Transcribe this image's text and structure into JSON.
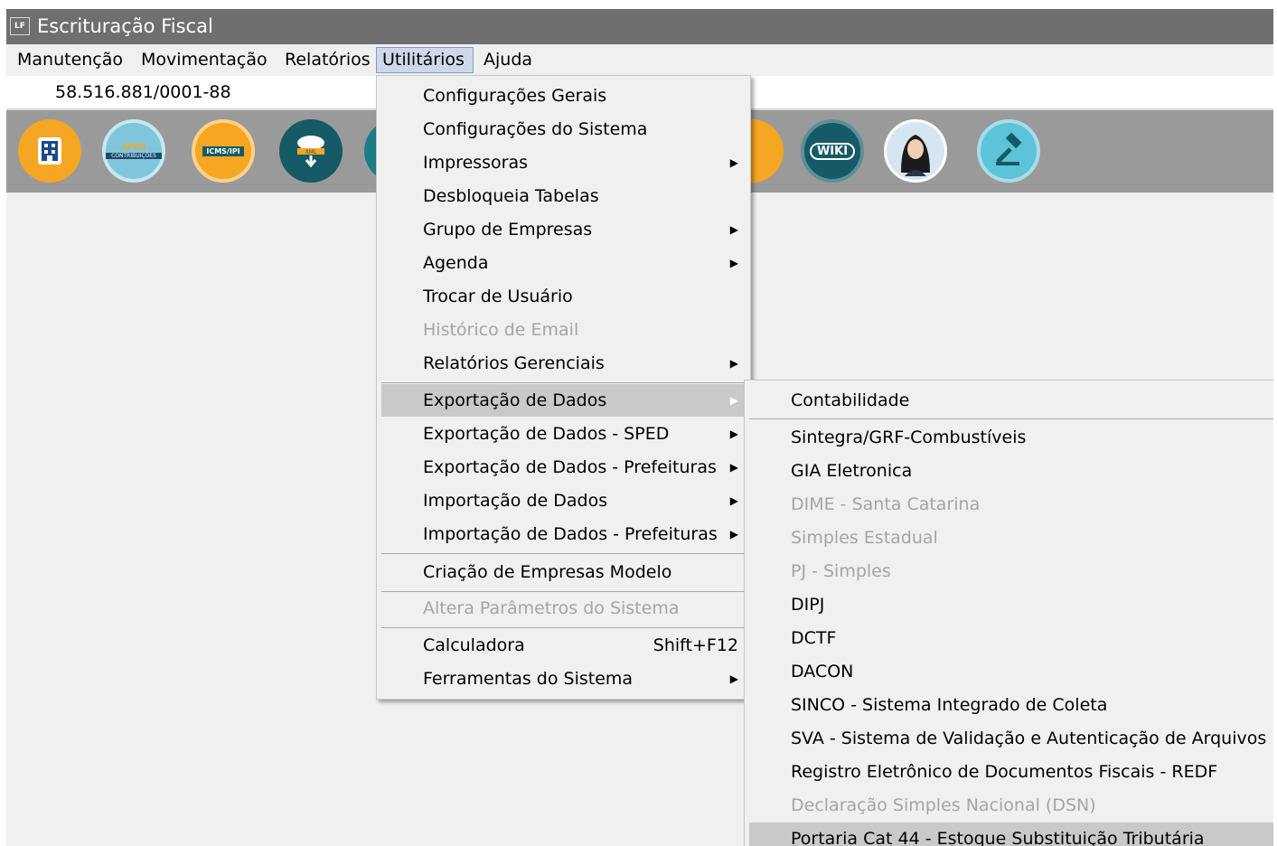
{
  "window": {
    "title": "Escrituração Fiscal",
    "app_icon_text": "LF"
  },
  "menubar": [
    "Manutenção",
    "Movimentação",
    "Relatórios",
    "Utilitários",
    "Ajuda"
  ],
  "company": {
    "cnpj": "58.516.881/0001-88"
  },
  "toolbar": {
    "icons": [
      {
        "name": "building-icon",
        "color": "#f5a623"
      },
      {
        "name": "sped-contribuicoes-icon",
        "text_top": "SPED",
        "text_bottom": "CONTRIBUIÇÕES",
        "color": "#7fc6dc"
      },
      {
        "name": "icms-ipi-icon",
        "text": "ICMS/IPI",
        "color": "#f5a623"
      },
      {
        "name": "cloud-xml-download-icon",
        "text": "XML",
        "color": "#155a66"
      },
      {
        "name": "wiki-icon",
        "text": "WIKI",
        "color": "#155a66"
      },
      {
        "name": "assistant-avatar-icon",
        "color": "#d6e6f0"
      },
      {
        "name": "gavel-icon",
        "color": "#5cc3d8"
      }
    ]
  },
  "utilitarios_menu": [
    {
      "label": "Configurações Gerais"
    },
    {
      "label": "Configurações do Sistema"
    },
    {
      "label": "Impressoras",
      "submenu": true
    },
    {
      "label": "Desbloqueia Tabelas"
    },
    {
      "label": "Grupo de Empresas",
      "submenu": true
    },
    {
      "label": "Agenda",
      "submenu": true
    },
    {
      "label": "Trocar de Usuário"
    },
    {
      "label": "Histórico de Email",
      "disabled": true
    },
    {
      "label": "Relatórios Gerenciais",
      "submenu": true
    },
    {
      "label": "Exportação de Dados",
      "submenu": true,
      "highlighted": true
    },
    {
      "label": "Exportação de Dados - SPED",
      "submenu": true
    },
    {
      "label": "Exportação de Dados - Prefeituras",
      "submenu": true
    },
    {
      "label": "Importação de Dados",
      "submenu": true
    },
    {
      "label": "Importação de Dados - Prefeituras",
      "submenu": true
    },
    {
      "label": "Criação de Empresas Modelo"
    },
    {
      "label": "Altera Parâmetros do Sistema",
      "disabled": true
    },
    {
      "label": "Calculadora",
      "shortcut": "Shift+F12"
    },
    {
      "label": "Ferramentas do Sistema",
      "submenu": true
    }
  ],
  "exportacao_submenu": [
    {
      "label": "Contabilidade"
    },
    {
      "label": "Sintegra/GRF-Combustíveis"
    },
    {
      "label": "GIA Eletronica"
    },
    {
      "label": "DIME - Santa Catarina",
      "disabled": true
    },
    {
      "label": "Simples Estadual",
      "disabled": true
    },
    {
      "label": "PJ - Simples",
      "disabled": true
    },
    {
      "label": "DIPJ"
    },
    {
      "label": "DCTF"
    },
    {
      "label": "DACON"
    },
    {
      "label": "SINCO - Sistema Integrado de Coleta"
    },
    {
      "label": "SVA - Sistema de Validação e Autenticação de Arquivos Digit"
    },
    {
      "label": "Registro Eletrônico de Documentos Fiscais - REDF"
    },
    {
      "label": "Declaração Simples Nacional (DSN)",
      "disabled": true
    },
    {
      "label": "Portaria Cat 44 - Estoque Substituição Tributária",
      "highlighted": true
    }
  ]
}
